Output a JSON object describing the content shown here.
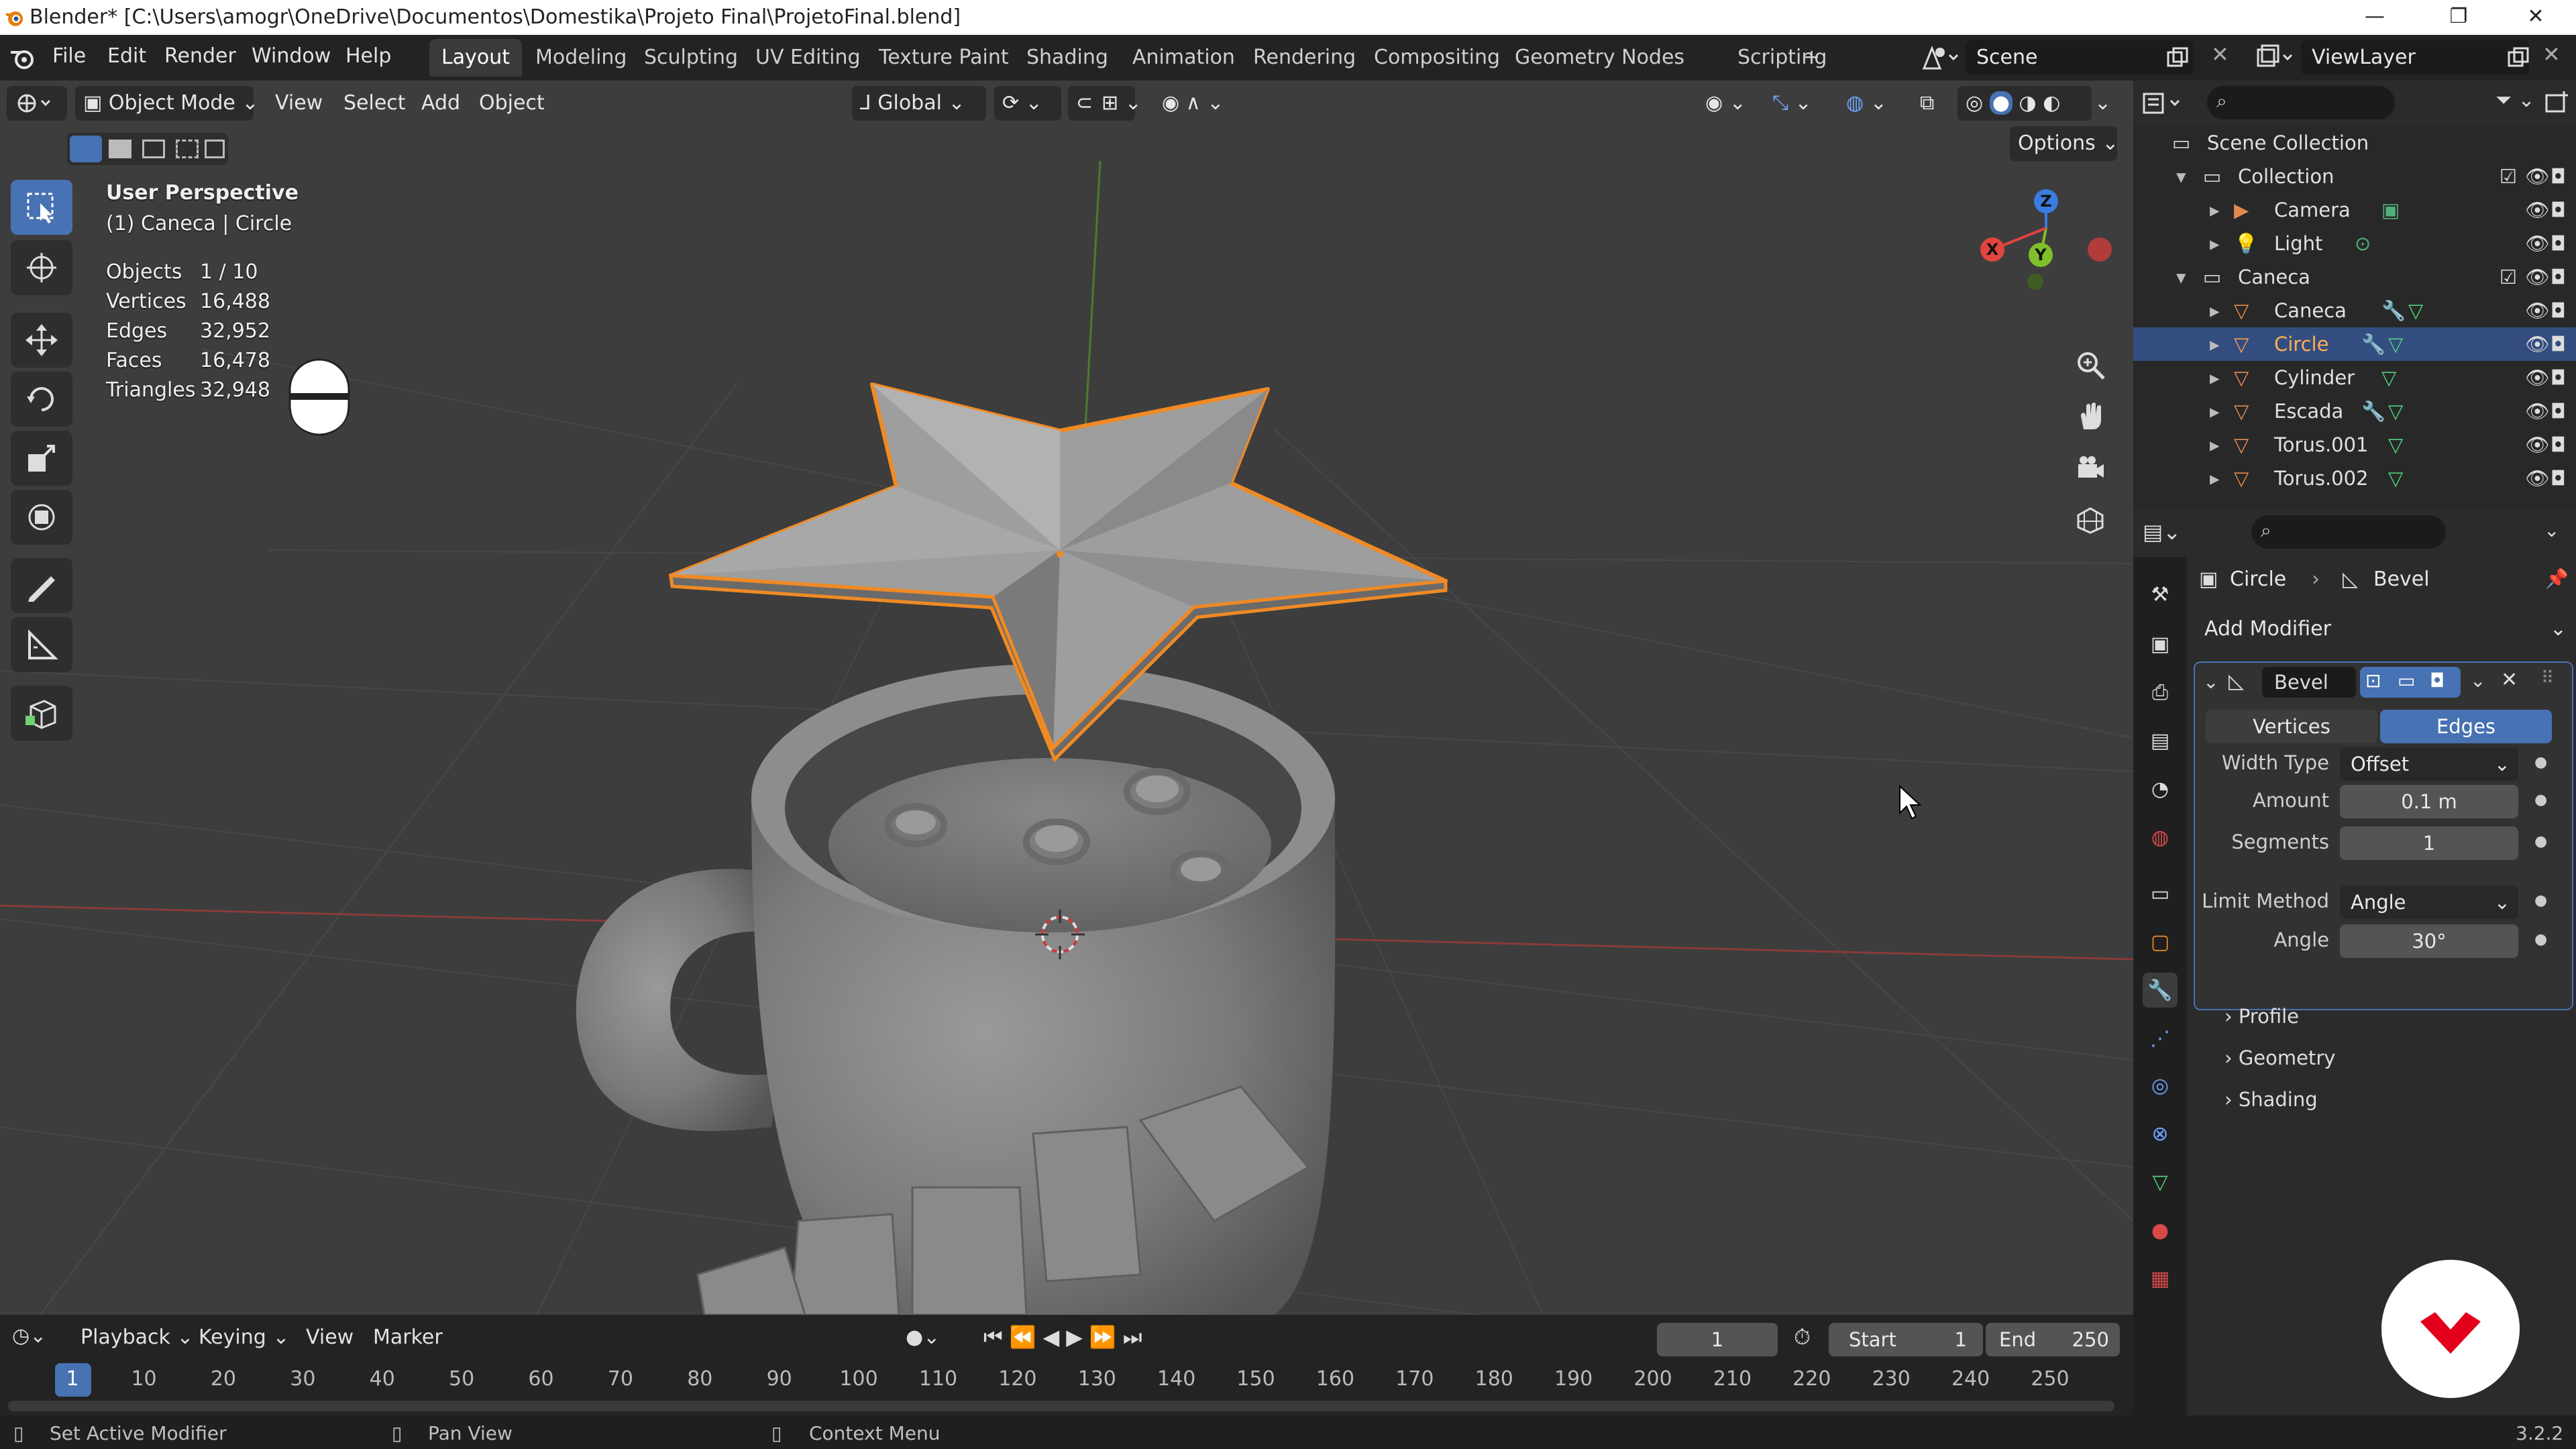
{
  "titlebar": {
    "title": "Blender* [C:\\Users\\amogr\\OneDrive\\Documentos\\Domestika\\Projeto Final\\ProjetoFinal.blend]",
    "minimize": "—",
    "maximize": "❐",
    "close": "✕"
  },
  "menu": {
    "items": [
      "File",
      "Edit",
      "Render",
      "Window",
      "Help"
    ]
  },
  "workspaces": {
    "tabs": [
      "Layout",
      "Modeling",
      "Sculpting",
      "UV Editing",
      "Texture Paint",
      "Shading",
      "Animation",
      "Rendering",
      "Compositing",
      "Geometry Nodes",
      "Scripting"
    ],
    "active": "Layout",
    "add": "+"
  },
  "scene": {
    "name": "Scene",
    "view_layer": "ViewLayer"
  },
  "viewport_header": {
    "mode": "Object Mode",
    "menus": [
      "View",
      "Select",
      "Add",
      "Object"
    ],
    "transform_orientation": "Global",
    "options": "Options"
  },
  "viewport": {
    "perspective": "User Perspective",
    "active_object": "(1) Caneca | Circle",
    "stats": [
      {
        "label": "Objects",
        "value": "1 / 10"
      },
      {
        "label": "Vertices",
        "value": "16,488"
      },
      {
        "label": "Edges",
        "value": "32,952"
      },
      {
        "label": "Faces",
        "value": "16,478"
      },
      {
        "label": "Triangles",
        "value": "32,948"
      }
    ],
    "gizmo": {
      "x": "X",
      "y": "Y",
      "z": "Z"
    }
  },
  "outliner": {
    "root": "Scene Collection",
    "rows": [
      {
        "label": "Collection",
        "type": "collection"
      },
      {
        "label": "Camera",
        "type": "camera"
      },
      {
        "label": "Light",
        "type": "light"
      },
      {
        "label": "Caneca",
        "type": "collection"
      },
      {
        "label": "Caneca",
        "type": "mesh"
      },
      {
        "label": "Circle",
        "type": "mesh"
      },
      {
        "label": "Cylinder",
        "type": "mesh"
      },
      {
        "label": "Escada",
        "type": "mesh"
      },
      {
        "label": "Torus.001",
        "type": "mesh"
      },
      {
        "label": "Torus.002",
        "type": "mesh"
      }
    ]
  },
  "properties": {
    "breadcrumb_object": "Circle",
    "breadcrumb_modifier": "Bevel",
    "add_modifier": "Add Modifier",
    "modifier_name": "Bevel",
    "affect_tabs": [
      "Vertices",
      "Edges"
    ],
    "affect_active": "Edges",
    "fields": {
      "width_type_label": "Width Type",
      "width_type": "Offset",
      "amount_label": "Amount",
      "amount": "0.1 m",
      "segments_label": "Segments",
      "segments": "1",
      "limit_method_label": "Limit Method",
      "limit_method": "Angle",
      "angle_label": "Angle",
      "angle": "30°"
    },
    "subpanels": [
      "Profile",
      "Geometry",
      "Shading"
    ]
  },
  "timeline": {
    "menus": [
      "Playback",
      "Keying",
      "View",
      "Marker"
    ],
    "current_frame": "1",
    "start_label": "Start",
    "start": "1",
    "end_label": "End",
    "end": "250",
    "ticks": [
      "1",
      "10",
      "20",
      "30",
      "40",
      "50",
      "60",
      "70",
      "80",
      "90",
      "100",
      "110",
      "120",
      "130",
      "140",
      "150",
      "160",
      "170",
      "180",
      "190",
      "200",
      "210",
      "220",
      "230",
      "240",
      "250"
    ]
  },
  "statusbar": {
    "left": "Set Active Modifier",
    "middle": "Pan View",
    "right": "Context Menu",
    "version": "3.2.2"
  },
  "colors": {
    "accent": "#4772b3",
    "selection_outline": "#f08a24",
    "x_axis": "#e0453e",
    "y_axis": "#7fbf2a",
    "z_axis": "#3a7de0",
    "brand": "#e3001b"
  }
}
